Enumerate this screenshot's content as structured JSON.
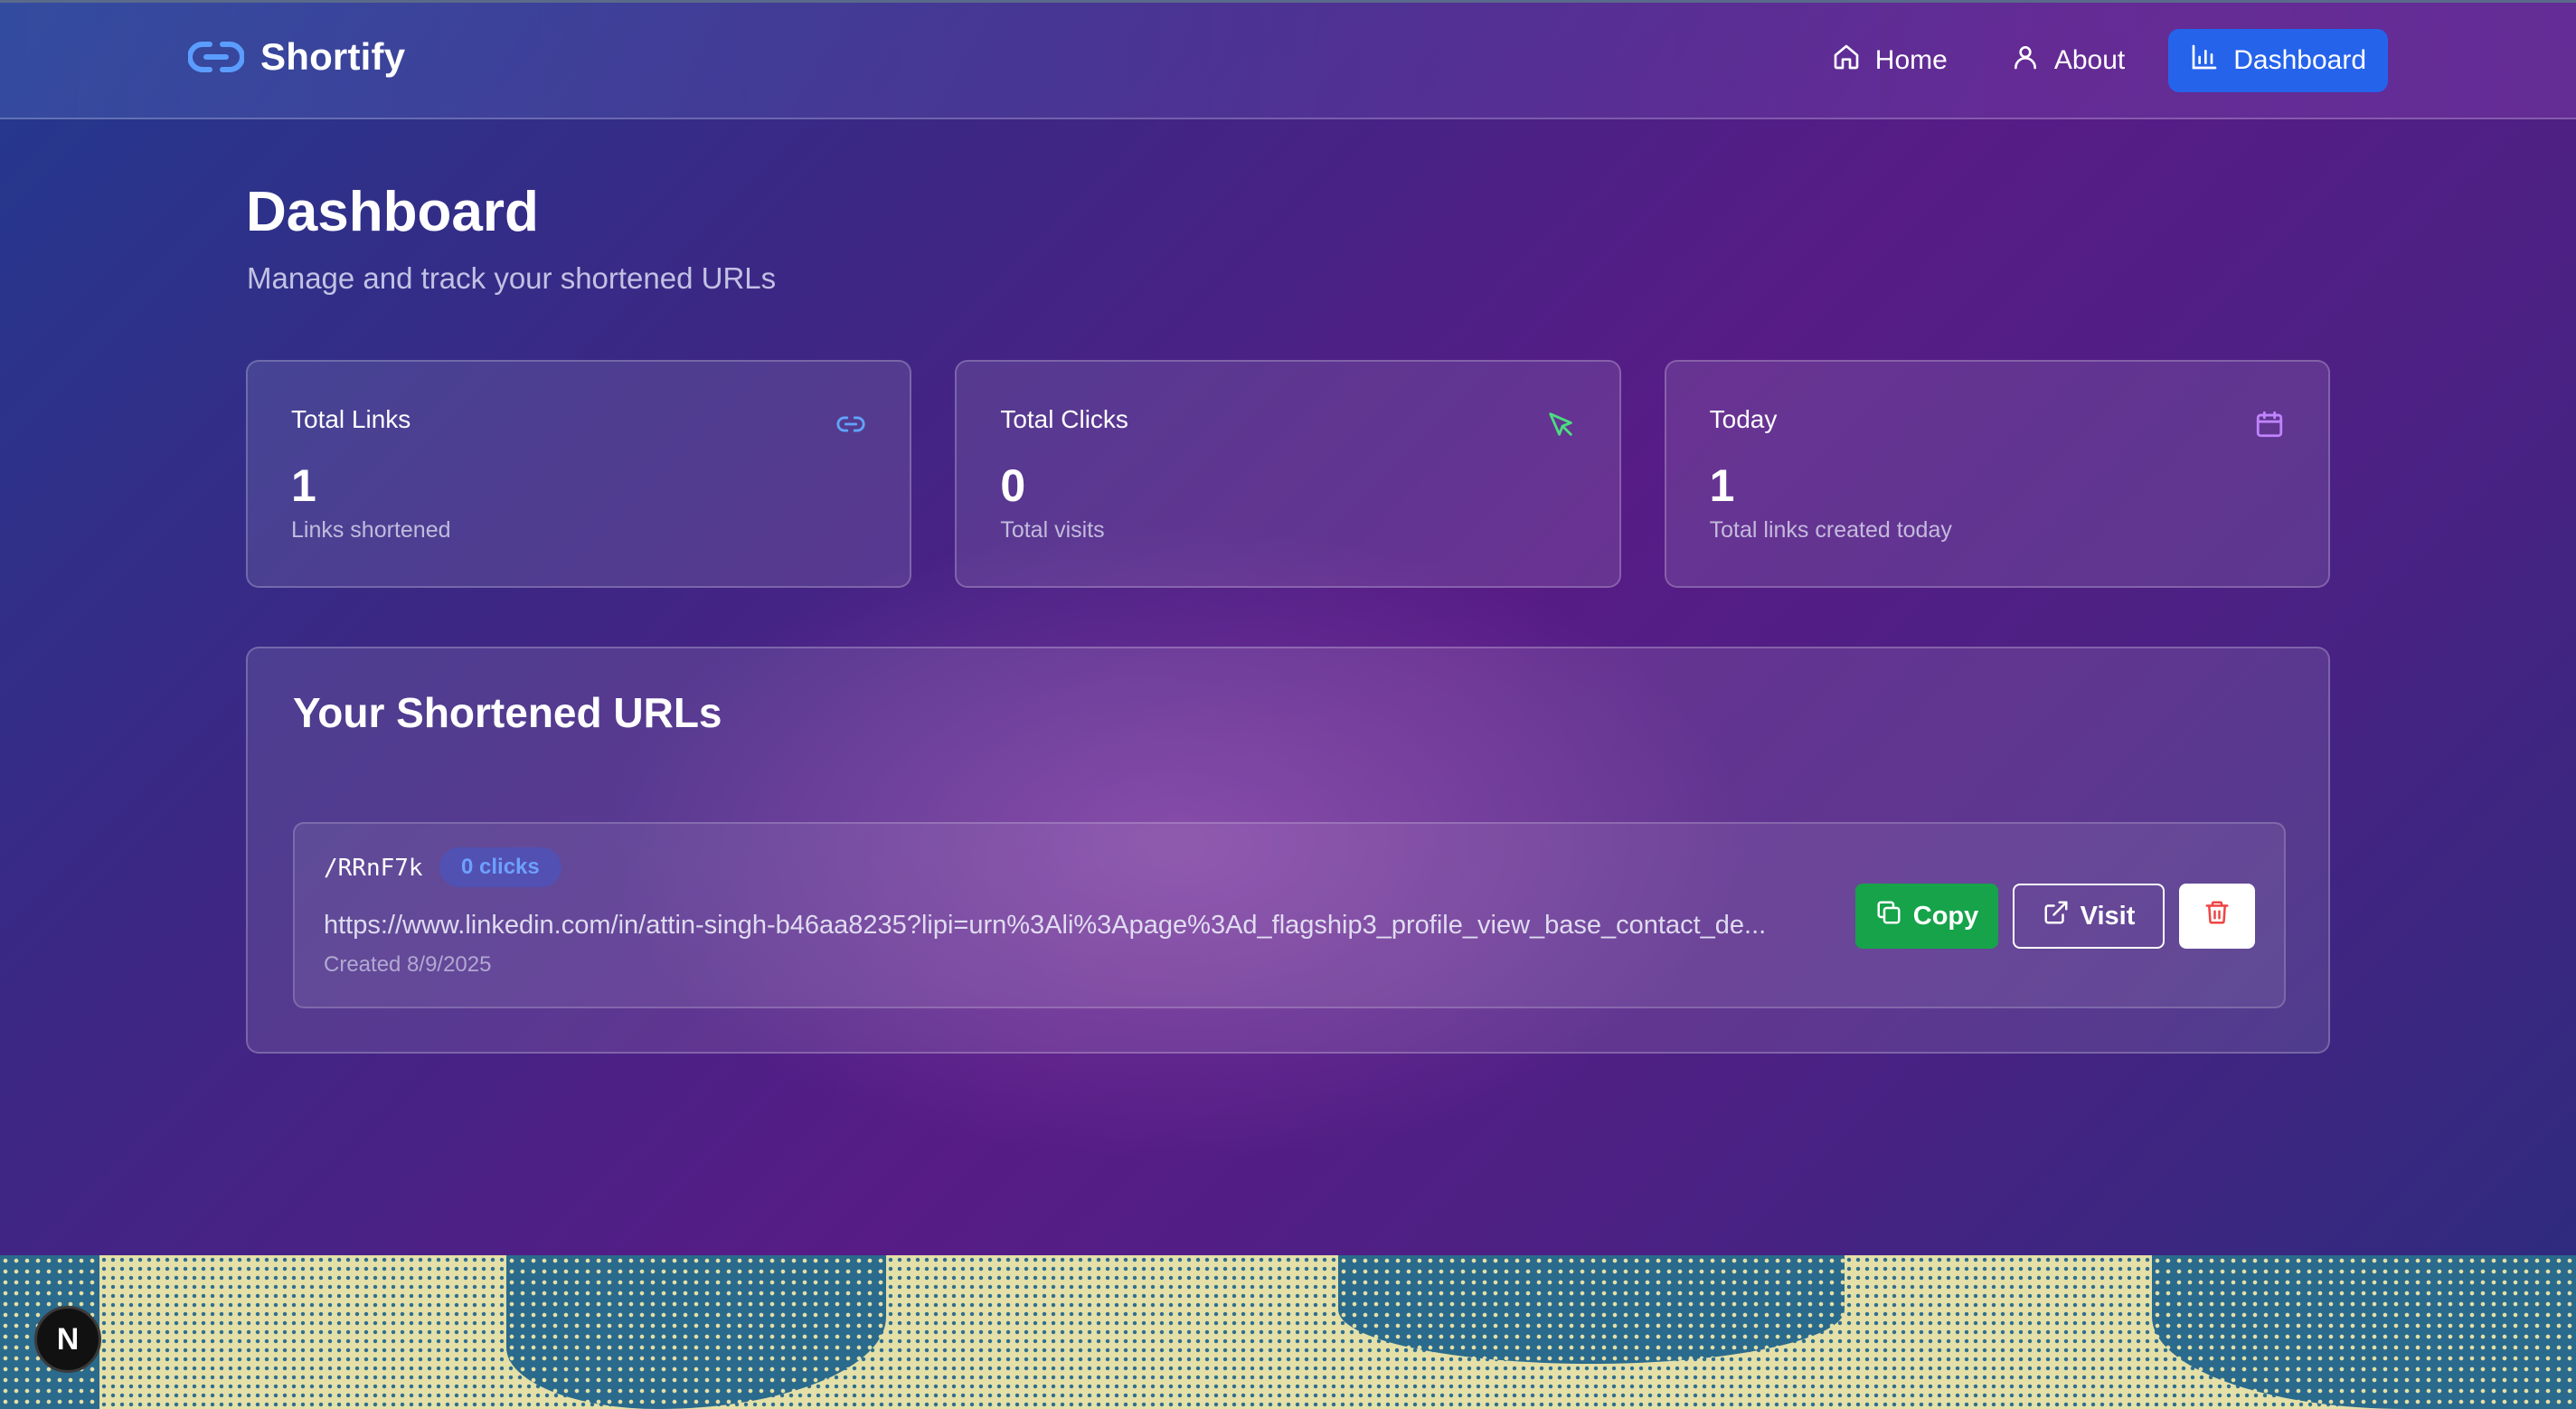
{
  "navbar": {
    "brand": "Shortify",
    "links": [
      {
        "label": "Home",
        "icon": "home-icon",
        "active": false
      },
      {
        "label": "About",
        "icon": "user-icon",
        "active": false
      },
      {
        "label": "Dashboard",
        "icon": "bar-chart-icon",
        "active": true
      }
    ]
  },
  "header": {
    "title": "Dashboard",
    "subtitle": "Manage and track your shortened URLs"
  },
  "stats": [
    {
      "label": "Total Links",
      "value": "1",
      "desc": "Links shortened",
      "icon": "link-icon",
      "icon_color": "#60a5fa"
    },
    {
      "label": "Total Clicks",
      "value": "0",
      "desc": "Total visits",
      "icon": "cursor-click-icon",
      "icon_color": "#4ade80"
    },
    {
      "label": "Today",
      "value": "1",
      "desc": "Total links created today",
      "icon": "calendar-icon",
      "icon_color": "#c084fc"
    }
  ],
  "urls": {
    "title": "Your Shortened URLs",
    "items": [
      {
        "code": "/RRnF7k",
        "clicks": "0 clicks",
        "original": "https://www.linkedin.com/in/attin-singh-b46aa8235?lipi=urn%3Ali%3Apage%3Ad_flagship3_profile_view_base_contact_de...",
        "created": "Created 8/9/2025",
        "copy_label": "Copy",
        "visit_label": "Visit"
      }
    ]
  },
  "footer_badge": "N",
  "colors": {
    "accent": "#2563eb",
    "copy": "#16a34a",
    "delete": "#ef4444"
  }
}
